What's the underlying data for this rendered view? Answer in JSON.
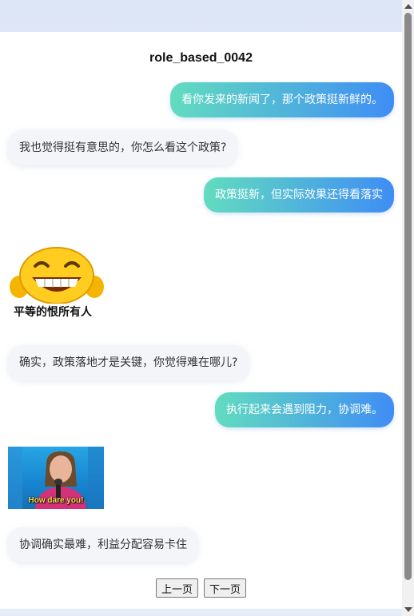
{
  "page": {
    "title": "role_based_0042"
  },
  "messages": [
    {
      "side": "out",
      "text": "看你发来的新闻了，那个政策挺新鲜的。"
    },
    {
      "side": "in",
      "text": "我也觉得挺有意思的，你怎么看这个政策?"
    },
    {
      "side": "out",
      "text": "政策挺新，但实际效果还得看落实"
    },
    {
      "side": "sticker",
      "icon": "laughing-face-sticker",
      "caption": "平等的恨所有人"
    },
    {
      "side": "in",
      "text": "确实，政策落地才是关键，你觉得难在哪儿?"
    },
    {
      "side": "out",
      "text": "执行起来会遇到阻力，协调难。"
    },
    {
      "side": "image",
      "icon": "how-dare-you-meme",
      "caption": "How dare you!"
    },
    {
      "side": "in",
      "text": "协调确实最难，利益分配容易卡住"
    }
  ],
  "pager": {
    "prev_label": "上一页",
    "next_label": "下一页"
  },
  "colors": {
    "out_start": "#62dcbf",
    "out_end": "#3f8df5",
    "in_bg": "#f3f5f9",
    "page_bg": "#dde6f7"
  }
}
